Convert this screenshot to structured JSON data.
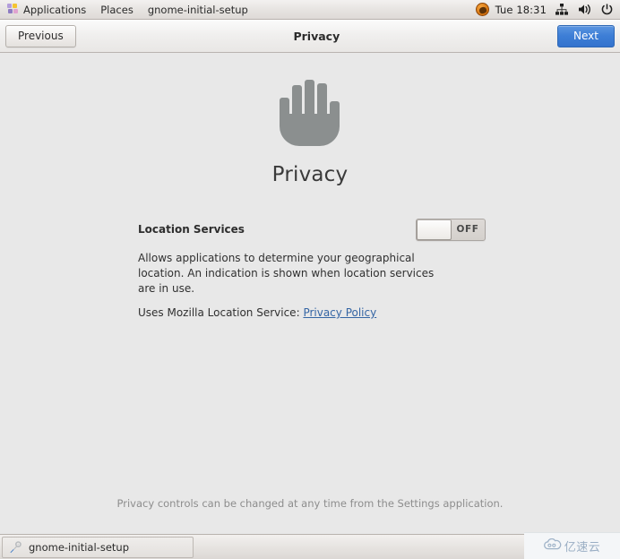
{
  "top_panel": {
    "applications_label": "Applications",
    "places_label": "Places",
    "window_label": "gnome-initial-setup",
    "clock": "Tue 18:31",
    "icons": {
      "applications": "applications-icon",
      "avatar": "user-avatar-icon",
      "network": "network-icon",
      "volume": "volume-icon",
      "power": "power-icon"
    }
  },
  "header": {
    "previous_label": "Previous",
    "title": "Privacy",
    "next_label": "Next",
    "next_color": "#3d7ed6"
  },
  "main": {
    "hero_icon": "hand-icon",
    "hero_icon_color": "#8b8f8f",
    "page_title": "Privacy",
    "location": {
      "label": "Location Services",
      "toggle_state": "OFF",
      "description": "Allows applications to determine your geographical location. An indication is shown when location services are in use.",
      "policy_prefix": "Uses Mozilla Location Service:",
      "policy_link": "Privacy Policy",
      "policy_link_color": "#3465a4"
    },
    "footer_note": "Privacy controls can be changed at any time from the Settings application."
  },
  "taskbar": {
    "item_label": "gnome-initial-setup",
    "item_icon": "gnome-initial-setup-icon"
  },
  "watermark": {
    "text": "亿速云",
    "icon": "cloud-icon"
  }
}
